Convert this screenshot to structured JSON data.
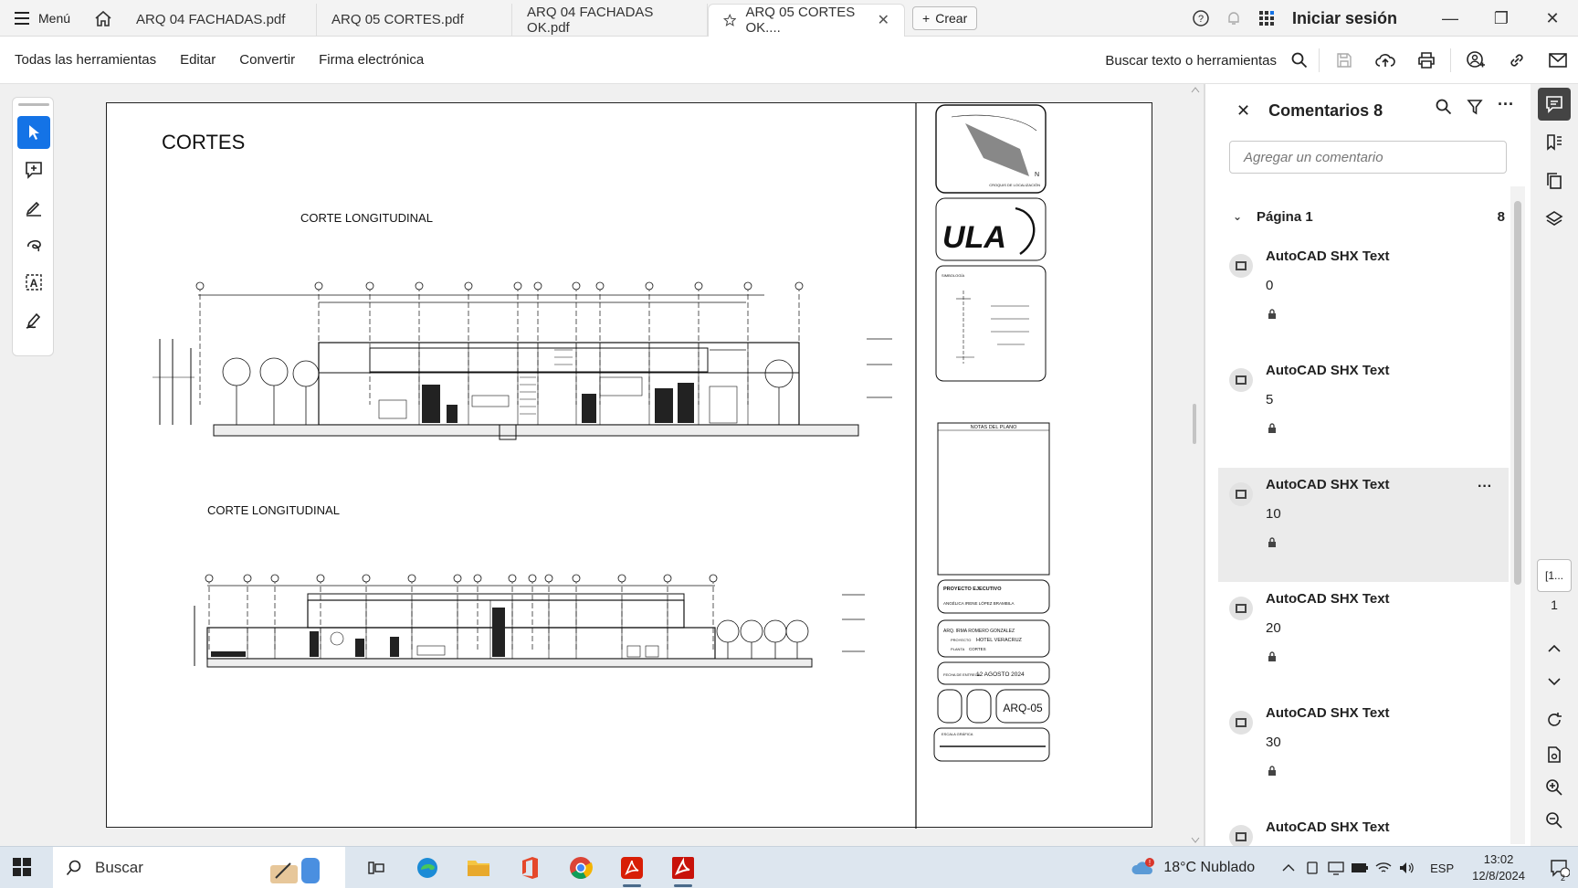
{
  "app": {
    "menu_label": "Menú",
    "tabs": [
      {
        "label": "ARQ 04 FACHADAS.pdf"
      },
      {
        "label": "ARQ 05 CORTES.pdf"
      },
      {
        "label": "ARQ 04 FACHADAS OK.pdf"
      },
      {
        "label": "ARQ 05 CORTES OK...."
      }
    ],
    "create_label": "Crear",
    "signin_label": "Iniciar sesión"
  },
  "toolbar": {
    "items": [
      "Todas las herramientas",
      "Editar",
      "Convertir",
      "Firma electrónica"
    ],
    "search_label": "Buscar texto o herramientas"
  },
  "drawing": {
    "title": "CORTES",
    "section1_label": "CORTE LONGITUDINAL",
    "section2_label": "CORTE LONGITUDINAL",
    "notes_title": "NOTAS DEL PLANO",
    "project_type": "PROYECTO EJECUTIVO",
    "student": "ANGÉLICA IRENE LÓPEZ BRAMBILA",
    "teacher": "ARQ. IRMA ROMERO GONZALEZ",
    "project_label": "PROYECTO",
    "project_name": "HOTEL VERACRUZ",
    "plan_label": "PLANTA",
    "plan_name": "CORTES",
    "date_label": "FECHA DE ENTREGA",
    "date": "12 AGOSTO 2024",
    "sheet_code": "ARQ-05",
    "scale_label": "ESCALA GRÁFICA",
    "location_caption": "CROQUIS DE LOCALIZACIÓN",
    "symbology_label": "SIMBOLOGÍA",
    "logo_text": "ULA"
  },
  "comments": {
    "title": "Comentarios 8",
    "placeholder": "Agregar un comentario",
    "page_group": "Página 1",
    "page_count": "8",
    "items": [
      {
        "author": "AutoCAD SHX Text",
        "text": "0"
      },
      {
        "author": "AutoCAD SHX Text",
        "text": "5"
      },
      {
        "author": "AutoCAD SHX Text",
        "text": "10"
      },
      {
        "author": "AutoCAD SHX Text",
        "text": "20"
      },
      {
        "author": "AutoCAD SHX Text",
        "text": "30"
      },
      {
        "author": "AutoCAD SHX Text",
        "text": ""
      }
    ]
  },
  "right_rail": {
    "page_indicator": "[1...",
    "page_number": "1"
  },
  "taskbar": {
    "search_label": "Buscar",
    "weather": "18°C  Nublado",
    "lang": "ESP",
    "time": "13:02",
    "date": "12/8/2024",
    "notif_count": "2"
  },
  "colors": {
    "accent": "#1473e6",
    "adobe_red": "#d81e06"
  }
}
